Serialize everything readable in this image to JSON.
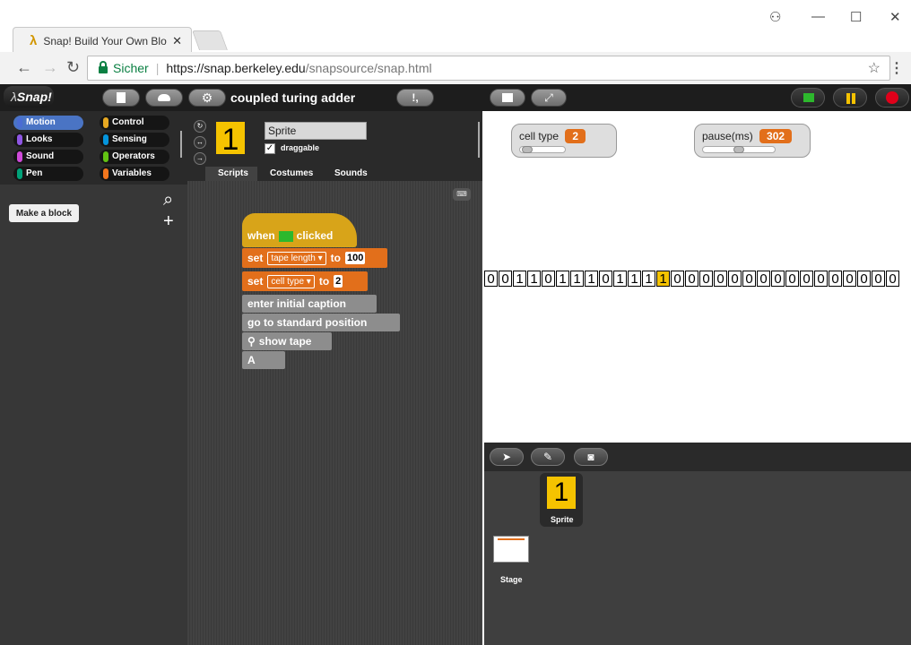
{
  "browser": {
    "tab_title": "Snap! Build Your Own Blo",
    "tab_close": "✕",
    "url_secure": "Sicher",
    "url_host": "https://snap.berkeley.edu",
    "url_path": "/snapsource/snap.html"
  },
  "snap": {
    "logo_text": "Snap!",
    "project_title": "coupled turing adder",
    "categories": [
      {
        "label": "Motion",
        "color": "#4a6cd4"
      },
      {
        "label": "Control",
        "color": "#e6a822"
      },
      {
        "label": "Looks",
        "color": "#8f56e3"
      },
      {
        "label": "Sensing",
        "color": "#0494dc"
      },
      {
        "label": "Sound",
        "color": "#cf4ad9"
      },
      {
        "label": "Operators",
        "color": "#62c213"
      },
      {
        "label": "Pen",
        "color": "#00a178"
      },
      {
        "label": "Variables",
        "color": "#f3761d"
      }
    ],
    "make_block": "Make a block",
    "sprite": {
      "costume_char": "1",
      "name": "Sprite",
      "draggable_label": "draggable",
      "draggable_checked": "✓"
    },
    "editor_tabs": [
      "Scripts",
      "Costumes",
      "Sounds"
    ],
    "script": {
      "hat_when": "when",
      "hat_clicked": "clicked",
      "set1": {
        "keyword": "set",
        "var": "tape length ▾",
        "to": "to",
        "value": "100"
      },
      "set2": {
        "keyword": "set",
        "var": "cell type ▾",
        "to": "to",
        "value": "2"
      },
      "block3": "enter initial caption",
      "block4": "go to standard position",
      "block5": "show tape",
      "block6": "A"
    },
    "watchers": [
      {
        "label": "cell type",
        "value": "2"
      },
      {
        "label": "pause(ms)",
        "value": "302"
      }
    ],
    "tape": [
      "0",
      "0",
      "1",
      "1",
      "0",
      "1",
      "1",
      "1",
      "0",
      "1",
      "1",
      "1",
      "1",
      "0",
      "0",
      "0",
      "0",
      "0",
      "0",
      "0",
      "0",
      "0",
      "0",
      "0",
      "0",
      "0",
      "0",
      "0",
      "0"
    ],
    "tape_highlight_index": 12,
    "corral": {
      "sprite_label": "Sprite",
      "stage_label": "Stage"
    }
  }
}
